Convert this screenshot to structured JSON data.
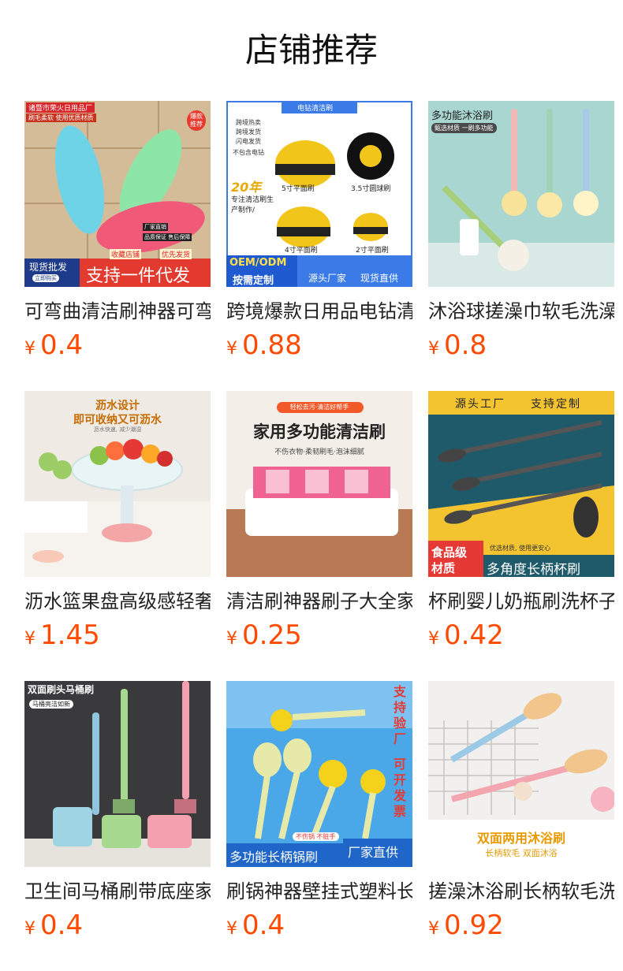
{
  "header": {
    "title": "店铺推荐"
  },
  "products": [
    {
      "name": "可弯曲清洁刷神器可弯曲清洁刷",
      "currency": "¥",
      "price": "0.4",
      "image_texts": [
        "诸暨市荣火日用品厂",
        "刷毛柔软 使用优质材质",
        "爆款推荐",
        "厂家直销",
        "品质保证 售后保障",
        "收藏店铺",
        "优先发货",
        "现货批发",
        "立即购买",
        "支持一件代发"
      ]
    },
    {
      "name": "跨境爆款日用品电钻清洁刷",
      "currency": "¥",
      "price": "0.88",
      "image_texts": [
        "电钻清洁刷",
        "跨境热卖",
        "跨境发货",
        "闪电发货",
        "不包含电钻",
        "5寸平面刷",
        "3.5寸圆球刷",
        "20年",
        "专注清洁刷生产制作/",
        "4寸平面刷",
        "2寸平面刷",
        "OEM/ODM",
        "按需定制",
        "源头厂家",
        "现货直供"
      ]
    },
    {
      "name": "沐浴球搓澡巾软毛洗澡刷",
      "currency": "¥",
      "price": "0.8",
      "image_texts": [
        "多功能沐浴刷",
        "甄选材质 一刷多功能"
      ]
    },
    {
      "name": "沥水篮果盘高级感轻奢",
      "currency": "¥",
      "price": "1.45",
      "image_texts": [
        "沥水设计",
        "即可收纳又可沥水",
        "沥水快速, 减少潮湿"
      ]
    },
    {
      "name": "清洁刷神器刷子大全家用",
      "currency": "¥",
      "price": "0.25",
      "image_texts": [
        "轻松去污·清洁好帮手",
        "家用多功能清洁刷",
        "不伤衣物·柔韧刷毛·泡沫细腻"
      ]
    },
    {
      "name": "杯刷婴儿奶瓶刷洗杯子",
      "currency": "¥",
      "price": "0.42",
      "image_texts": [
        "源头工厂",
        "支持定制",
        "食品级",
        "材质",
        "优选材质, 使用更安心",
        "多角度长柄杯刷"
      ]
    },
    {
      "name": "卫生间马桶刷带底座家用",
      "currency": "¥",
      "price": "0.4",
      "image_texts": [
        "双面刷头马桶刷",
        "马桶亮洁如新"
      ]
    },
    {
      "name": "刷锅神器壁挂式塑料长柄",
      "currency": "¥",
      "price": "0.4",
      "image_texts": [
        "支持验厂",
        "可开发票",
        "不伤锅 不脏手",
        "多功能长柄锅刷",
        "厂家直供"
      ]
    },
    {
      "name": "搓澡沐浴刷长柄软毛洗澡",
      "currency": "¥",
      "price": "0.92",
      "image_texts": [
        "双面两用沐浴刷",
        "长柄软毛 双面沐浴"
      ]
    }
  ]
}
